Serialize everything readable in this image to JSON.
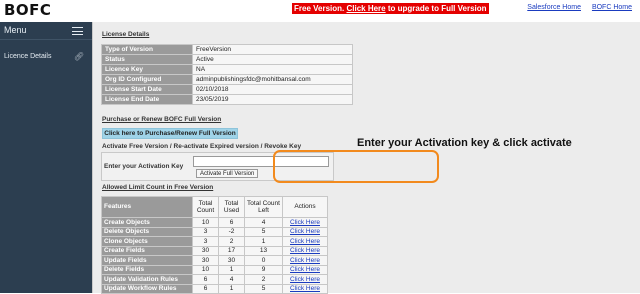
{
  "app": {
    "brand": "BOFC"
  },
  "promo": {
    "prefix": "Free Version.",
    "link": "Click Here",
    "suffix": "to upgrade to Full Version"
  },
  "toplinks": [
    "Salesforce Home",
    "BOFC Home"
  ],
  "sidebar": {
    "title": "Menu",
    "items": [
      {
        "label": "Licence Details",
        "icon": "link-icon"
      }
    ]
  },
  "license": {
    "title": "License Details",
    "rows": [
      {
        "key": "Type of Version",
        "value": "FreeVersion"
      },
      {
        "key": "Status",
        "value": "Active"
      },
      {
        "key": "Licence Key",
        "value": "NA"
      },
      {
        "key": "Org ID Configured",
        "value": "adminpublishingsfdc@mohitbansal.com"
      },
      {
        "key": "License Start Date",
        "value": "02/10/2018"
      },
      {
        "key": "License End Date",
        "value": "23/05/2019"
      }
    ]
  },
  "purchase": {
    "title": "Purchase or Renew BOFC Full Version",
    "button": "Click here to Purchase/Renew Full Version"
  },
  "activation": {
    "title": "Activate Free Version / Re-activate Expired version / Revoke Key",
    "label": "Enter your Activation Key",
    "input_value": "",
    "button": "Activate Full Version",
    "callout": "Enter your Activation key & click activate",
    "highlight_color": "#f28a1d"
  },
  "limits": {
    "title": "Allowed Limit Count in Free Version",
    "headers": [
      "Features",
      "Total Count",
      "Total Used",
      "Total Count Left",
      "Actions"
    ],
    "rows": [
      {
        "feature": "Create Objects",
        "total": "10",
        "used": "6",
        "left": "4",
        "action": "Click Here"
      },
      {
        "feature": "Delete Objects",
        "total": "3",
        "used": "-2",
        "left": "5",
        "action": "Click Here"
      },
      {
        "feature": "Clone Objects",
        "total": "3",
        "used": "2",
        "left": "1",
        "action": "Click Here"
      },
      {
        "feature": "Create Fields",
        "total": "30",
        "used": "17",
        "left": "13",
        "action": "Click Here"
      },
      {
        "feature": "Update Fields",
        "total": "30",
        "used": "30",
        "left": "0",
        "action": "Click Here"
      },
      {
        "feature": "Delete Fields",
        "total": "10",
        "used": "1",
        "left": "9",
        "action": "Click Here"
      },
      {
        "feature": "Update Validation Rules",
        "total": "6",
        "used": "4",
        "left": "2",
        "action": "Click Here"
      },
      {
        "feature": "Update Workflow Rules",
        "total": "6",
        "used": "1",
        "left": "5",
        "action": "Click Here"
      }
    ]
  },
  "colors": {
    "sidebar": "#2c3e50",
    "promo": "#e40000",
    "link": "#1a3bbf",
    "header_cell": "#9a9a9a",
    "purchase_button": "#9fd3e8"
  }
}
